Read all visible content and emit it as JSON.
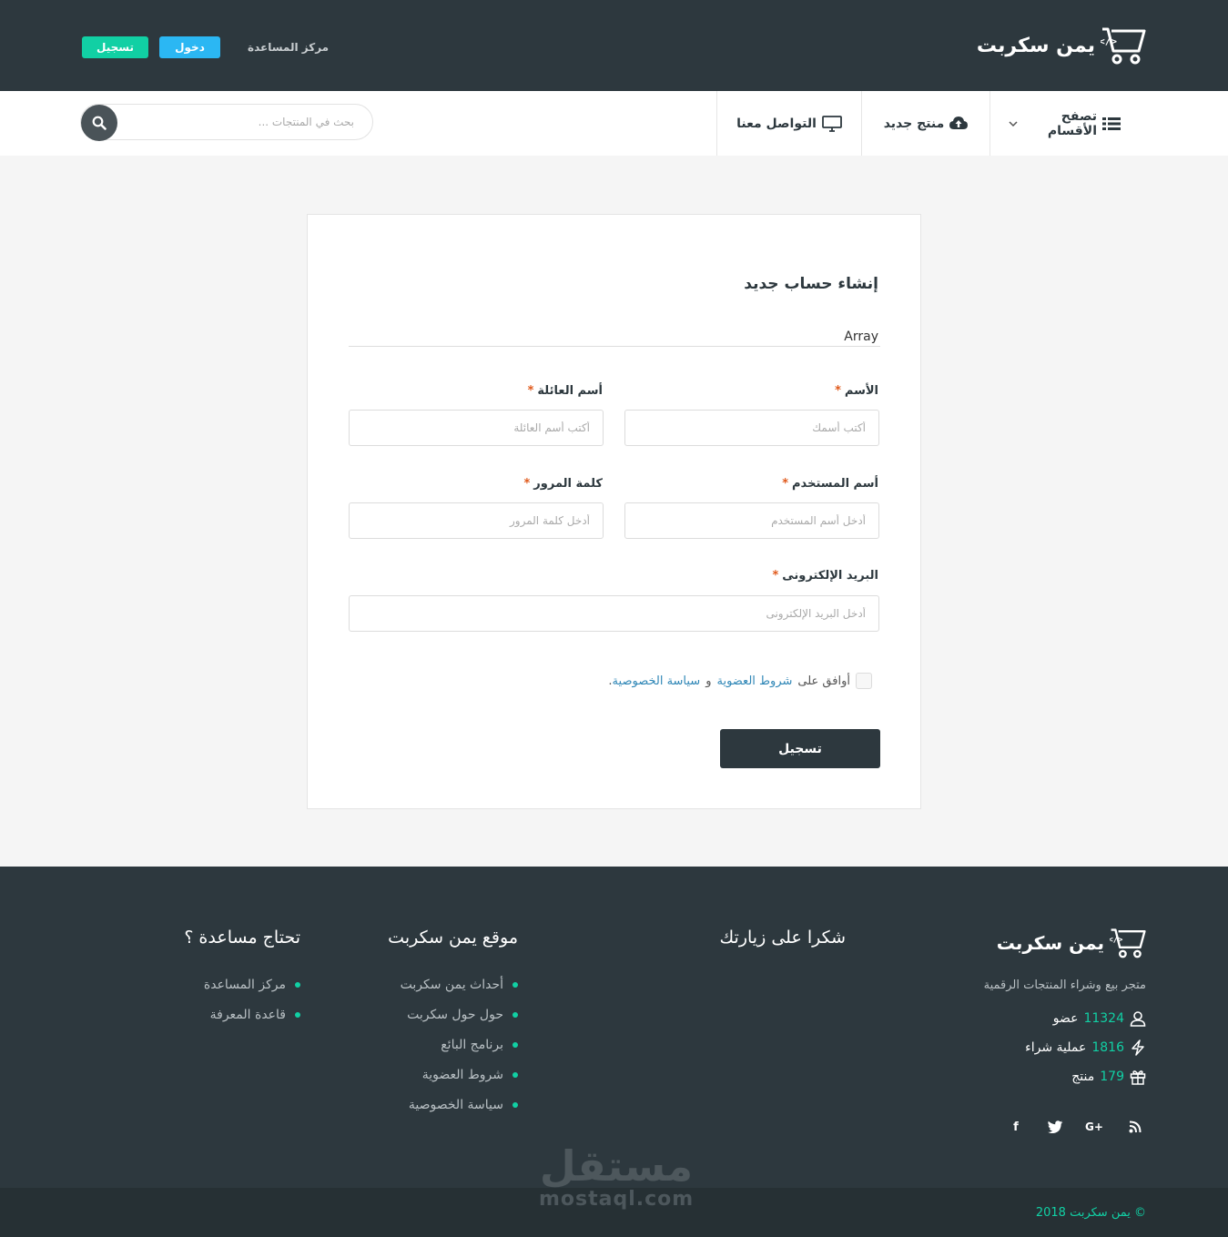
{
  "brand": {
    "name": "يمن سكربت"
  },
  "topbar": {
    "register_label": "تسجيل",
    "login_label": "دخول",
    "help_label": "مركز المساعدة"
  },
  "nav": {
    "browse_label": "تصفح الأقسام",
    "new_product_label": "منتج جديد",
    "contact_label": "التواصل معنا",
    "search_placeholder": "بحث في المنتجات ..."
  },
  "form": {
    "title": "إنشاء حساب جديد",
    "notice": "Array",
    "first_name": {
      "label": "الأسم",
      "placeholder": "أكتب أسمك"
    },
    "last_name": {
      "label": "أسم العائلة",
      "placeholder": "أكتب أسم العائلة"
    },
    "username": {
      "label": "أسم المستخدم",
      "placeholder": "أدخل أسم المستخدم"
    },
    "password": {
      "label": "كلمة المرور",
      "placeholder": "أدخل كلمة المرور"
    },
    "email": {
      "label": "البريد الإلكترونى",
      "placeholder": "أدخل البريد الإلكترونى"
    },
    "required_mark": "*",
    "agree_prefix": "أوافق على",
    "terms_link": "شروط العضوية",
    "agree_and": "و",
    "privacy_link": "سياسة الخصوصية",
    "agree_suffix": ".",
    "submit_label": "تسجيل"
  },
  "footer": {
    "description": "متجر بيع وشراء المنتجات الرقمية",
    "stats": [
      {
        "num": "11324",
        "label": "عضو",
        "icon": "user-icon"
      },
      {
        "num": "1816",
        "label": "عملية شراء",
        "icon": "bolt-icon"
      },
      {
        "num": "179",
        "label": "منتج",
        "icon": "gift-icon"
      }
    ],
    "social": {
      "facebook": "f",
      "google": "G+"
    },
    "thanks_title": "شكرا على زيارتك",
    "site_title": "موقع يمن سكربت",
    "site_links": [
      "أحداث يمن سكربت",
      "حول حول سكربت",
      "برنامج البائع",
      "شروط العضوية",
      "سياسة الخصوصية"
    ],
    "help_title": "تحتاج مساعدة ؟",
    "help_links": [
      "مركز المساعدة",
      "قاعدة المعرفة"
    ],
    "copyright": "© يمن سكربت 2018"
  },
  "watermark": {
    "ar": "مستقل",
    "en": "mostaql.com"
  },
  "colors": {
    "dark": "#2d383e",
    "accent_green": "#11d0a4",
    "accent_blue": "#2bb7f3",
    "required": "#e0591b",
    "link": "#2e86b6"
  }
}
